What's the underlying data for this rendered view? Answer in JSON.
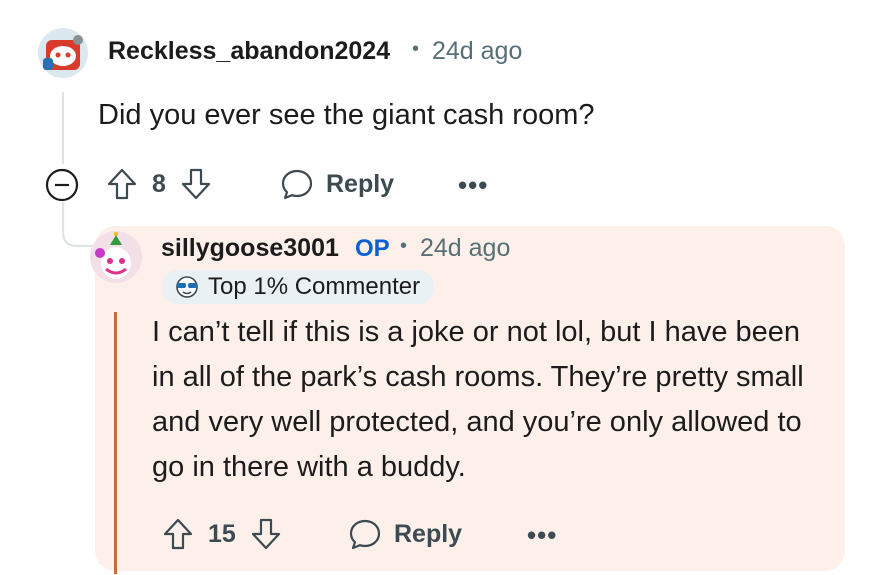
{
  "comment": {
    "username": "Reckless_abandon2024",
    "age": "24d ago",
    "body": "Did you ever see the giant cash room?",
    "votes": "8",
    "reply_label": "Reply",
    "more_label": "•••"
  },
  "reply": {
    "username": "sillygoose3001",
    "op_badge": "OP",
    "age": "24d ago",
    "flair": "Top 1% Commenter",
    "body": "I can’t tell if this is a joke or not lol, but I have been in all of the park’s cash rooms. They’re pretty small and very well protected, and you’re only allowed to go in there with a buddy.",
    "votes": "15",
    "reply_label": "Reply",
    "more_label": "•••"
  },
  "colors": {
    "accent_op": "#0a5fd6",
    "reply_background": "#fdf0ea",
    "reply_thread_line": "#c96a3a"
  },
  "icons": [
    "collapse-icon",
    "upvote-icon",
    "downvote-icon",
    "comment-bubble-icon",
    "more-icon",
    "sunglasses-icon"
  ]
}
